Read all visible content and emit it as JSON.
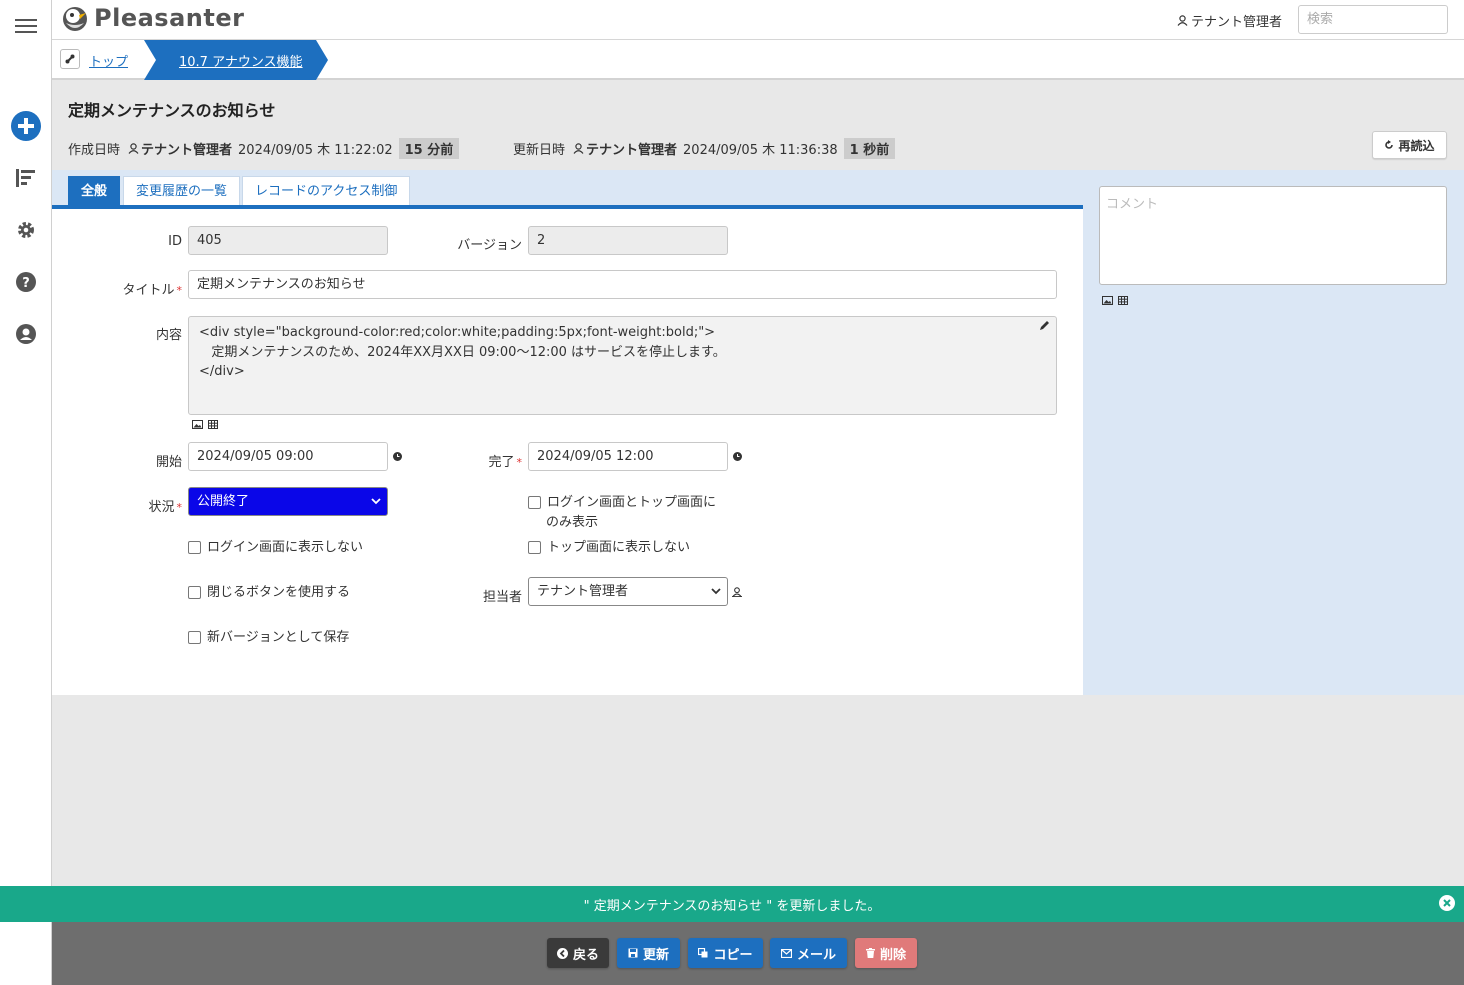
{
  "app": {
    "logo_text": "Pleasanter",
    "current_user": "テナント管理者",
    "search_placeholder": "検索"
  },
  "breadcrumb": {
    "items": [
      {
        "label": "トップ"
      },
      {
        "label": "10.7 アナウンス機能"
      }
    ]
  },
  "record": {
    "title": "定期メンテナンスのお知らせ",
    "created_label": "作成日時",
    "created_by": "テナント管理者",
    "created_at": "2024/09/05 木 11:22:02",
    "created_ago": "15 分前",
    "updated_label": "更新日時",
    "updated_by": "テナント管理者",
    "updated_at": "2024/09/05 木 11:36:38",
    "updated_ago": "1 秒前",
    "reload_label": "再読込"
  },
  "tabs": [
    {
      "label": "全般",
      "active": true
    },
    {
      "label": "変更履歴の一覧",
      "active": false
    },
    {
      "label": "レコードのアクセス制御",
      "active": false
    }
  ],
  "form": {
    "id_label": "ID",
    "id_value": "405",
    "version_label": "バージョン",
    "version_value": "2",
    "title_label": "タイトル",
    "title_value": "定期メンテナンスのお知らせ",
    "body_label": "内容",
    "body_lines": [
      "<div style=\"background-color:red;color:white;padding:5px;font-weight:bold;\">",
      "   定期メンテナンスのため、2024年XX月XX日 09:00～12:00 はサービスを停止します。",
      "</div>"
    ],
    "start_label": "開始",
    "start_value": "2024/09/05 09:00",
    "end_label": "完了",
    "end_value": "2024/09/05 12:00",
    "status_label": "状況",
    "status_value": "公開終了",
    "login_top_only_line1": "ログイン画面とトップ画面に",
    "login_top_only_line2": "のみ表示",
    "hide_login": "ログイン画面に表示しない",
    "hide_top": "トップ画面に表示しない",
    "use_close_button": "閉じるボタンを使用する",
    "assignee_label": "担当者",
    "assignee_value": "テナント管理者",
    "save_new_version": "新バージョンとして保存",
    "required_mark": "*"
  },
  "comment": {
    "placeholder": "コメント"
  },
  "notice": {
    "message": "\" 定期メンテナンスのお知らせ \" を更新しました。"
  },
  "footer": {
    "back": "戻る",
    "update": "更新",
    "copy": "コピー",
    "mail": "メール",
    "delete": "削除"
  },
  "colors": {
    "primary": "#1d6fbf",
    "notice": "#19a88a",
    "status_select": "#0a06e8",
    "delete": "#e07a7a",
    "back": "#3a3a3a"
  }
}
